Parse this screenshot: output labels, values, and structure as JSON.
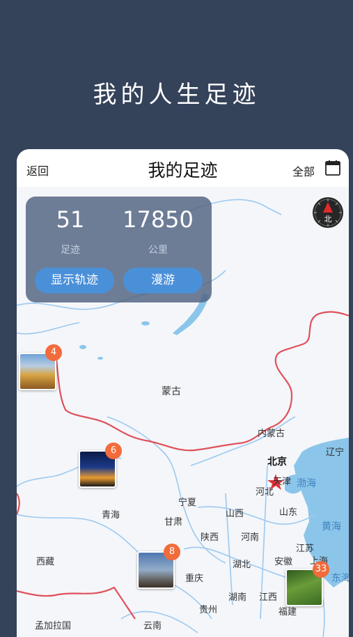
{
  "headline": "我的人生足迹",
  "header": {
    "back_label": "返回",
    "title": "我的足迹",
    "filter_label": "全部",
    "calendar_icon": "calendar-icon"
  },
  "stats": {
    "footprints_value": "51",
    "footprints_label": "足迹",
    "distance_value": "17850",
    "distance_label": "公里",
    "show_track_label": "显示轨迹",
    "roam_label": "漫游"
  },
  "compass": {
    "label": "北",
    "icon": "compass-icon"
  },
  "map_labels": {
    "mongolia": "蒙古",
    "inner_mongolia": "内蒙古",
    "beijing": "北京",
    "tianjin": "天津",
    "liaoning": "辽宁",
    "bohai": "渤海",
    "hebei": "河北",
    "ningxia": "宁夏",
    "qinghai": "青海",
    "gansu": "甘肃",
    "shanxi": "山西",
    "shandong": "山东",
    "yellow_sea": "黄海",
    "shaanxi": "陕西",
    "henan": "河南",
    "jiangsu": "江苏",
    "tibet": "西藏",
    "hubei": "湖北",
    "anhui": "安徽",
    "shanghai": "上海",
    "chongqing": "重庆",
    "east_sea": "东海",
    "hunan": "湖南",
    "jiangxi": "江西",
    "guizhou": "贵州",
    "fujian": "福建",
    "yunnan": "云南",
    "bangladesh": "孟加拉国"
  },
  "markers": [
    {
      "count": "4"
    },
    {
      "count": "6"
    },
    {
      "count": "8"
    },
    {
      "count": "33"
    }
  ],
  "colors": {
    "background": "#34425a",
    "border_red": "#e0505a",
    "accent_blue": "#4a90d9",
    "badge_orange": "#f26b3a"
  }
}
